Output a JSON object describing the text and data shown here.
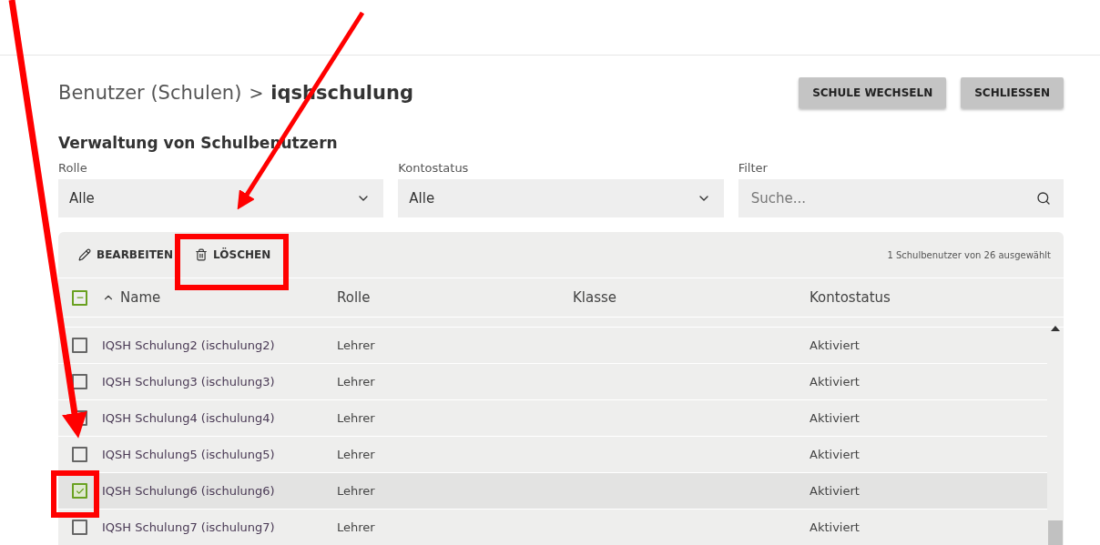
{
  "breadcrumb": {
    "parent": "Benutzer (Schulen)",
    "separator": ">",
    "current": "iqshschulung"
  },
  "header_buttons": [
    "SCHULE WECHSELN",
    "SCHLIESSEN"
  ],
  "section_title": "Verwaltung von Schulbenutzern",
  "filters": [
    {
      "kind": "select",
      "label": "Rolle",
      "value": "Alle"
    },
    {
      "kind": "select",
      "label": "Kontostatus",
      "value": "Alle"
    },
    {
      "kind": "search",
      "label": "Filter",
      "placeholder": "Suche..."
    }
  ],
  "toolbar": {
    "actions": [
      {
        "kind": "edit",
        "label": "BEARBEITEN"
      },
      {
        "kind": "delete",
        "label": "LÖSCHEN"
      }
    ],
    "selection_info": "1 Schulbenutzer von 26 ausgewählt"
  },
  "table": {
    "select_all": {
      "indeterminate": true
    },
    "columns": [
      {
        "label": "Name",
        "sorted": true
      },
      {
        "label": "Rolle",
        "sorted": false
      },
      {
        "label": "Klasse",
        "sorted": false
      },
      {
        "label": "Kontostatus",
        "sorted": false
      }
    ],
    "rows": [
      {
        "name": "IQSH Schulung2 (ischulung2)",
        "role": "Lehrer",
        "status": "Aktiviert",
        "checked": false
      },
      {
        "name": "IQSH Schulung3 (ischulung3)",
        "role": "Lehrer",
        "status": "Aktiviert",
        "checked": false
      },
      {
        "name": "IQSH Schulung4 (ischulung4)",
        "role": "Lehrer",
        "status": "Aktiviert",
        "checked": false
      },
      {
        "name": "IQSH Schulung5 (ischulung5)",
        "role": "Lehrer",
        "status": "Aktiviert",
        "checked": false
      },
      {
        "name": "IQSH Schulung6 (ischulung6)",
        "role": "Lehrer",
        "status": "Aktiviert",
        "checked": true
      },
      {
        "name": "IQSH Schulung7 (ischulung7)",
        "role": "Lehrer",
        "status": "Aktiviert",
        "checked": false
      }
    ]
  }
}
